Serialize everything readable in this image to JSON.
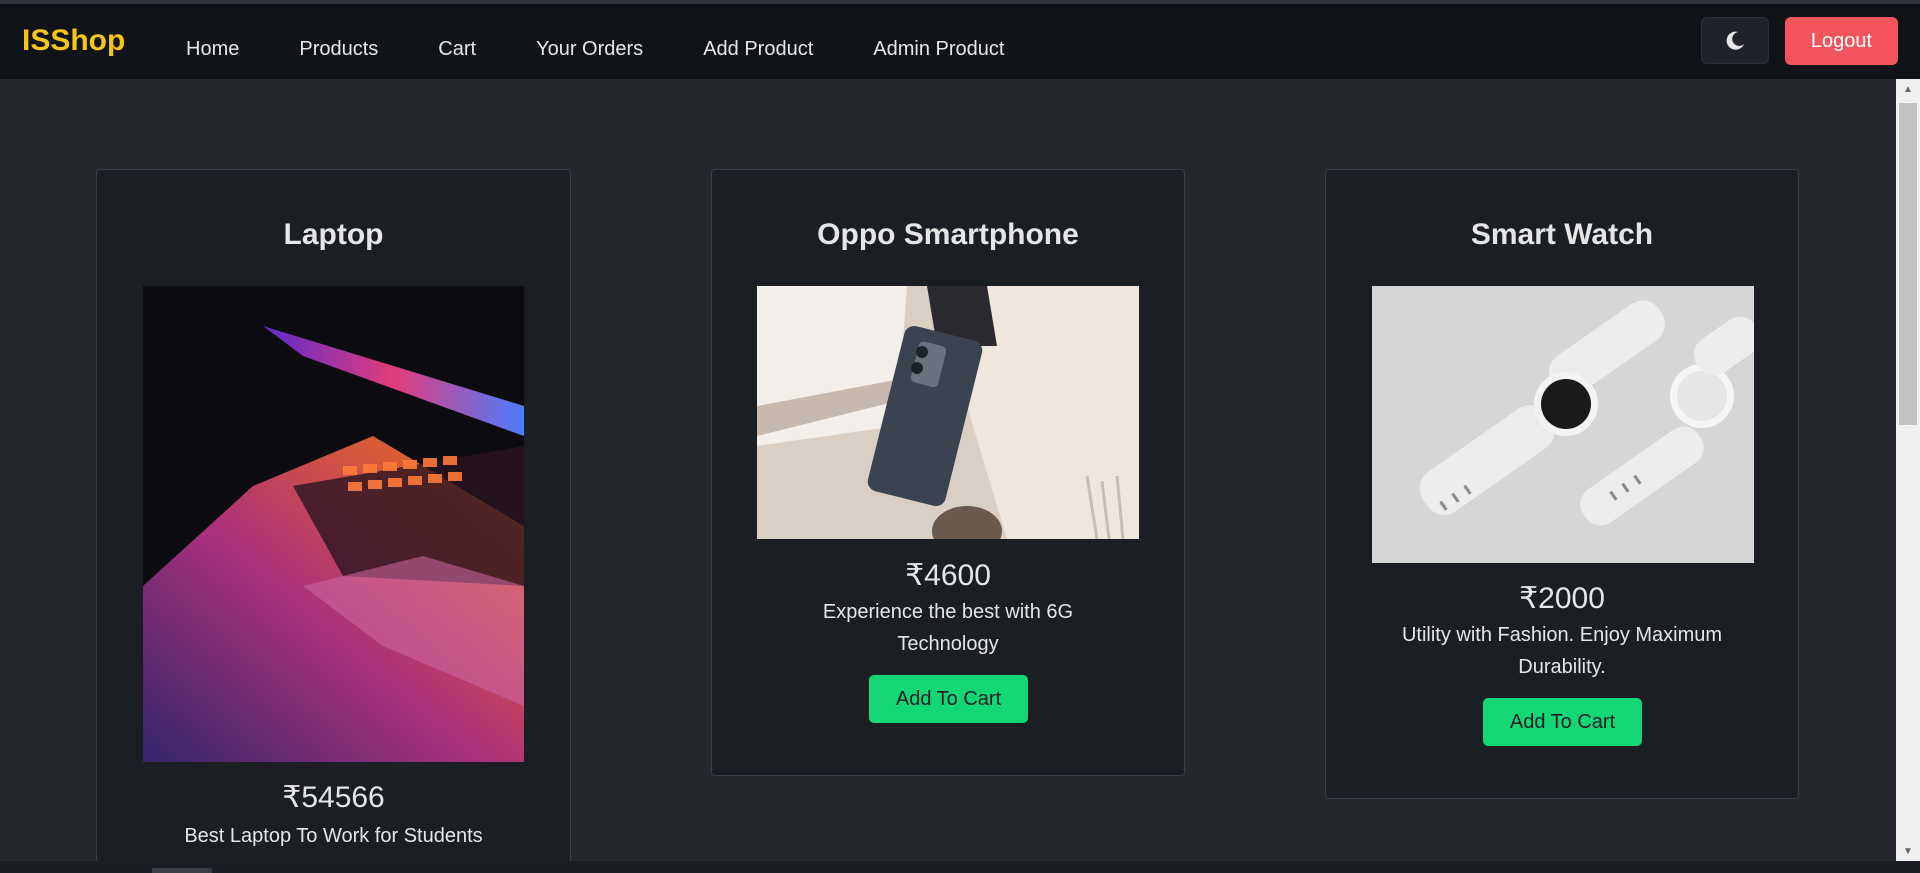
{
  "navbar": {
    "brand": "ISShop",
    "links": [
      "Home",
      "Products",
      "Cart",
      "Your Orders",
      "Add Product",
      "Admin Product"
    ],
    "theme_icon": "moon-icon",
    "logout_label": "Logout"
  },
  "colors": {
    "brand": "#f5c518",
    "logout": "#f2545b",
    "add_to_cart": "#13d774",
    "page_bg": "#24272c",
    "card_bg": "#1b1e23",
    "navbar_bg": "#101318"
  },
  "products": [
    {
      "title": "Laptop",
      "image": "laptop-photo",
      "price": "₹54566",
      "description": "Best Laptop To Work for Students"
    },
    {
      "title": "Oppo Smartphone",
      "image": "smartphone-photo",
      "price": "₹4600",
      "description": "Experience the best with 6G Technology",
      "button_label": "Add To Cart"
    },
    {
      "title": "Smart Watch",
      "image": "smartwatch-photo",
      "price": "₹2000",
      "description": "Utility with Fashion. Enjoy Maximum Durability.",
      "button_label": "Add To Cart"
    }
  ]
}
